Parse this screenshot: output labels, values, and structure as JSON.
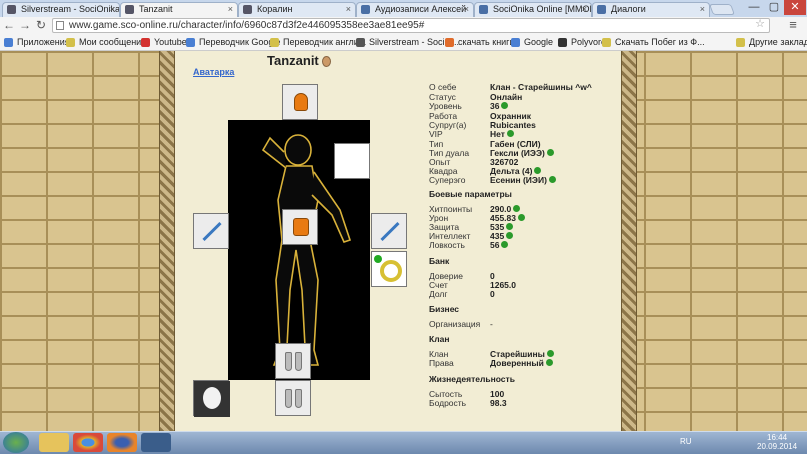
{
  "browser": {
    "tabs": [
      {
        "label": "Silverstream - SociOnika",
        "active": false
      },
      {
        "label": "Tanzanit",
        "active": true
      },
      {
        "label": "Коралин",
        "active": false
      },
      {
        "label": "Аудиозаписи Алексей",
        "active": false
      },
      {
        "label": "SociOnika Online [MMOR",
        "active": false
      },
      {
        "label": "Диалоги",
        "active": false
      }
    ],
    "url": "www.game.sco-online.ru/character/info/6960c87d3f2e446095358ee3ae81ee95#",
    "bookmarks": [
      "Приложения",
      "Мои сообщения",
      "Youtube",
      "Переводчик Google",
      "Переводчик англи...",
      "Silverstream - SociO...",
      "скачать книги",
      "Google",
      "Polyvore",
      "Скачать Побег из Ф..."
    ],
    "bookmarks_other": "Другие закладки",
    "window_controls": [
      "—",
      "▢",
      "✕"
    ]
  },
  "character": {
    "name": "Tanzanit",
    "avatar_link": "Аватарка",
    "info": [
      {
        "label": "О себе",
        "value": "Клан - Старейшины ^w^",
        "dot": false
      },
      {
        "label": "Статус",
        "value": "Онлайн",
        "dot": false
      },
      {
        "label": "Уровень",
        "value": "36",
        "dot": true
      },
      {
        "label": "Работа",
        "value": "Охранник",
        "dot": false
      },
      {
        "label": "Супруг(а)",
        "value": "Rubicantes",
        "dot": false
      },
      {
        "label": "VIP",
        "value": "Нет",
        "dot": true
      },
      {
        "label": "Тип",
        "value": "Габен (СЛИ)",
        "dot": false
      },
      {
        "label": "Тип дуала",
        "value": "Гексли (ИЭЭ)",
        "dot": true
      },
      {
        "label": "Опыт",
        "value": "326702",
        "dot": false
      },
      {
        "label": "Квадра",
        "value": "Дельта (4)",
        "dot": true
      },
      {
        "label": "Суперэго",
        "value": "Есенин (ИЭИ)",
        "dot": true
      }
    ],
    "combat_title": "Боевые параметры",
    "combat": [
      {
        "label": "Хитпоинты",
        "value": "290.0",
        "dot": true
      },
      {
        "label": "Урон",
        "value": "455.83",
        "dot": true
      },
      {
        "label": "Защита",
        "value": "535",
        "dot": true
      },
      {
        "label": "Интеллект",
        "value": "435",
        "dot": true
      },
      {
        "label": "Ловкость",
        "value": "56",
        "dot": true
      }
    ],
    "bank_title": "Банк",
    "bank": [
      {
        "label": "Доверие",
        "value": "0"
      },
      {
        "label": "Счет",
        "value": "1265.0"
      },
      {
        "label": "Долг",
        "value": "0"
      }
    ],
    "business_title": "Бизнес",
    "business": [
      {
        "label": "Организация",
        "value": "-"
      }
    ],
    "clan_title": "Клан",
    "clan": [
      {
        "label": "Клан",
        "value": "Старейшины",
        "dot": true
      },
      {
        "label": "Права",
        "value": "Доверенный",
        "dot": true
      }
    ],
    "life_title": "Жизнедеятельность",
    "life": [
      {
        "label": "Сытость",
        "value": "100"
      },
      {
        "label": "Бодрость",
        "value": "98.3"
      }
    ]
  },
  "taskbar": {
    "lang": "RU",
    "time": "16:44",
    "date": "20.09.2014"
  }
}
